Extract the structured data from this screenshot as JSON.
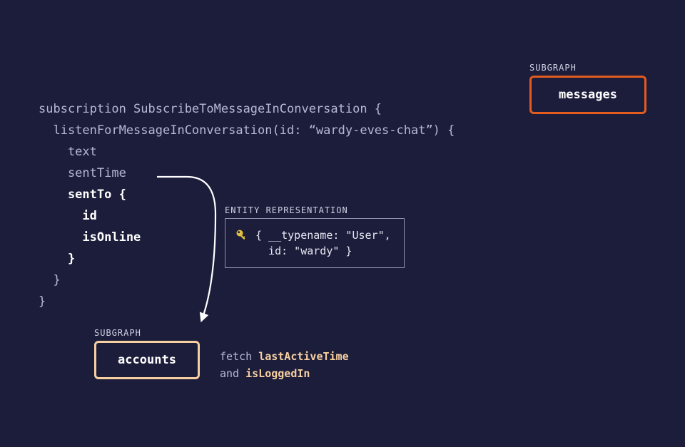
{
  "code": {
    "line1": "subscription SubscribeToMessageInConversation {",
    "line2": "  listenForMessageInConversation(id: “wardy-eves-chat”) {",
    "line3": "    text",
    "line4": "    sentTime",
    "line5_bold": "    sentTo {",
    "line6_bold": "      id",
    "line7_bold": "      isOnline",
    "line8_bold": "    }",
    "line9": "  }",
    "line10": "}"
  },
  "subgraphs": {
    "label": "SUBGRAPH",
    "messages": "messages",
    "accounts": "accounts"
  },
  "entity": {
    "label": "ENTITY REPRESENTATION",
    "line1": "{ __typename: \"User\",",
    "line2": "  id: \"wardy\" }"
  },
  "fetch": {
    "prefix": "fetch ",
    "field1": "lastActiveTime",
    "joiner": "and ",
    "field2": "isLoggedIn"
  },
  "colors": {
    "bg": "#1c1d3b",
    "messages_border": "#e35b1f",
    "accounts_border": "#f6cfa0",
    "highlight": "#f6cfa0"
  }
}
